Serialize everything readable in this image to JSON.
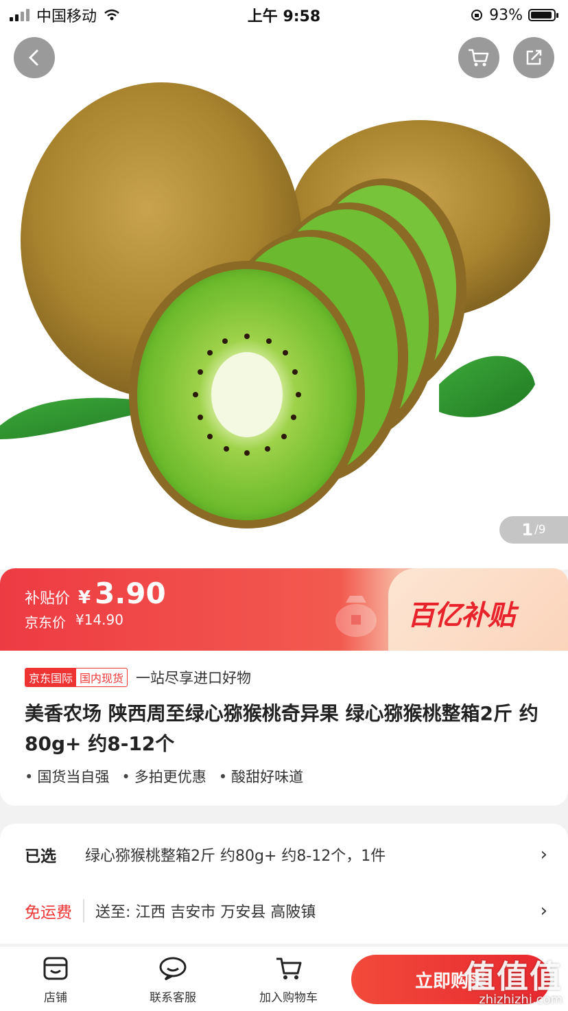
{
  "status_bar": {
    "carrier": "中国移动",
    "time": "上午 9:58",
    "battery_text": "93%",
    "battery_level": 0.93
  },
  "hero": {
    "page_current": "1",
    "page_total": "9"
  },
  "price": {
    "subsidy_label": "补贴价",
    "currency": "¥",
    "subsidy_price": "3.90",
    "jd_label": "京东价",
    "jd_price": "¥14.90",
    "brand": "百亿补贴"
  },
  "product": {
    "tag_a": "京东国际",
    "tag_b": "国内现货",
    "tag_slogan": "一站尽享进口好物",
    "title": "美香农场 陕西周至绿心猕猴桃奇异果 绿心猕猴桃整箱2斤 约80g+ 约8-12个",
    "bullets": [
      "国货当自强",
      "多拍更优惠",
      "酸甜好味道"
    ]
  },
  "options": {
    "selected_label": "已选",
    "selected_value": "绿心猕猴桃整箱2斤 约80g+ 约8-12个，1件",
    "shipping_label": "免运费",
    "shipping_value": "送至: 江西  吉安市  万安县  高陂镇"
  },
  "bottom_nav": {
    "store": "店铺",
    "service": "联系客服",
    "cart": "加入购物车",
    "buy": "立即购买"
  },
  "watermark": {
    "logo": "值值值",
    "domain": "zhizhizhi.com"
  },
  "colors": {
    "accent": "#e8232b",
    "banner": "#ee3b43"
  }
}
